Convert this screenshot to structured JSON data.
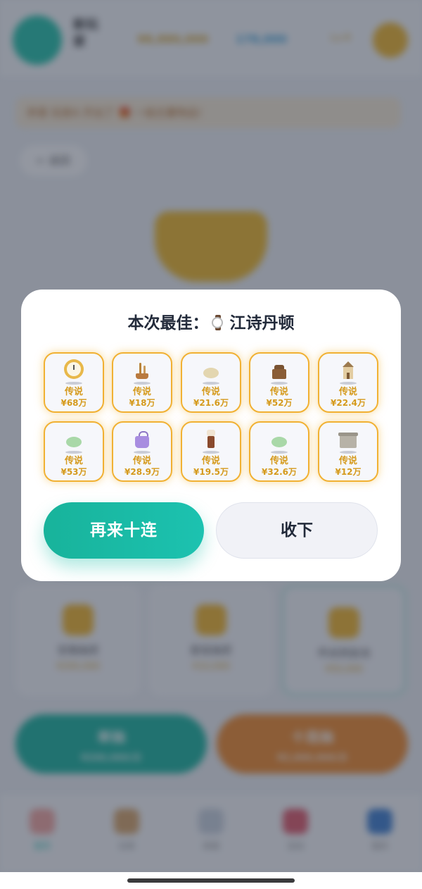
{
  "background": {
    "user": {
      "name": "新玩家"
    },
    "stats": {
      "gold": "98,880,000",
      "diamond": "178,000",
      "level": "Lv.9"
    },
    "notice": "恭喜 玩家A 开出了 🎁 一级古董物品!",
    "back_label": "返回",
    "cards": [
      {
        "title": "宝箱抽奖",
        "value": "¥200,000"
      },
      {
        "title": "星级抽奖",
        "value": "¥10,000"
      },
      {
        "title": "传说奖励池",
        "value": "¥50,000"
      }
    ],
    "actions": [
      {
        "title": "单抽",
        "subtitle": "¥200,000/次"
      },
      {
        "title": "十连抽",
        "subtitle": "¥2,000,000/次"
      }
    ],
    "tabs": [
      "首页",
      "仓库",
      "商城",
      "活动",
      "我的"
    ]
  },
  "modal": {
    "title_prefix": "本次最佳：",
    "best_item_name": "江诗丹顿",
    "best_item_icon": "watch-icon",
    "items": [
      {
        "icon": "watch",
        "rarity": "传说",
        "price": "¥68万"
      },
      {
        "icon": "bonsai",
        "rarity": "传说",
        "price": "¥18万"
      },
      {
        "icon": "egg",
        "rarity": "传说",
        "price": "¥21.6万"
      },
      {
        "icon": "cabinet",
        "rarity": "传说",
        "price": "¥52万"
      },
      {
        "icon": "house",
        "rarity": "传说",
        "price": "¥22.4万"
      },
      {
        "icon": "jade",
        "rarity": "传说",
        "price": "¥53万"
      },
      {
        "icon": "bag",
        "rarity": "传说",
        "price": "¥28.9万"
      },
      {
        "icon": "lamp",
        "rarity": "传说",
        "price": "¥19.5万"
      },
      {
        "icon": "jade",
        "rarity": "传说",
        "price": "¥32.6万"
      },
      {
        "icon": "box",
        "rarity": "传说",
        "price": "¥12万"
      }
    ],
    "retry_label": "再来十连",
    "accept_label": "收下"
  },
  "colors": {
    "accent_teal": "#1cc2b0",
    "legend_gold": "#d59a1c",
    "item_border": "#f1b133"
  }
}
